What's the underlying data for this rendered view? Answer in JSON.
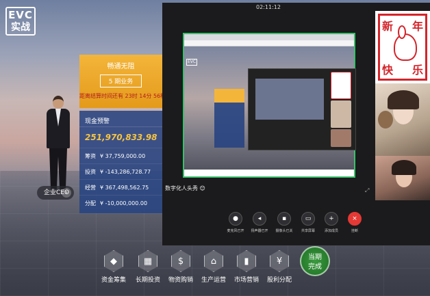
{
  "logo": {
    "line1": "EVC",
    "line2": "实战"
  },
  "ceo": {
    "button_label": "企业CEO",
    "arrow": "›"
  },
  "period": {
    "title": "畅通无阻",
    "badge": "5 期业务",
    "countdown": "距离结算时间还有 23时 14分 56秒"
  },
  "cash": {
    "header": "现金预警",
    "total": "251,970,833.98",
    "rows": [
      {
        "label": "筹资",
        "value": "¥ 37,759,000.00"
      },
      {
        "label": "投资",
        "value": "¥ -143,286,728.77"
      },
      {
        "label": "经营",
        "value": "¥ 367,498,562.75"
      },
      {
        "label": "分配",
        "value": "¥ -10,000,000.00"
      }
    ]
  },
  "call": {
    "timer": "02:11:12",
    "presenter_name": "数字化人头秀",
    "presenter_emoji": "😊",
    "controls": [
      {
        "label": "麦克风已开",
        "icon": "microphone-icon"
      },
      {
        "label": "扬声器已开",
        "icon": "speaker-icon"
      },
      {
        "label": "摄像头已关",
        "icon": "camera-off-icon"
      },
      {
        "label": "共享屏幕",
        "icon": "screen-share-icon"
      },
      {
        "label": "添加成员",
        "icon": "add-member-icon"
      },
      {
        "label": "挂断",
        "icon": "hang-up-icon"
      }
    ]
  },
  "participants": {
    "card_chars": [
      "新",
      "年",
      "快",
      "乐"
    ]
  },
  "menu": [
    {
      "label": "资金筹集",
      "icon": "diamond-icon"
    },
    {
      "label": "长期投资",
      "icon": "calculator-icon"
    },
    {
      "label": "物资购销",
      "icon": "money-bag-icon"
    },
    {
      "label": "生产运营",
      "icon": "house-icon"
    },
    {
      "label": "市场营销",
      "icon": "bar-chart-icon"
    },
    {
      "label": "股利分配",
      "icon": "hand-coin-icon"
    }
  ],
  "done_button": {
    "line1": "当期",
    "line2": "完成"
  },
  "colors": {
    "accent": "#f3b53a",
    "panel": "#28448a",
    "total": "#f5c443",
    "hangup": "#e53935"
  }
}
